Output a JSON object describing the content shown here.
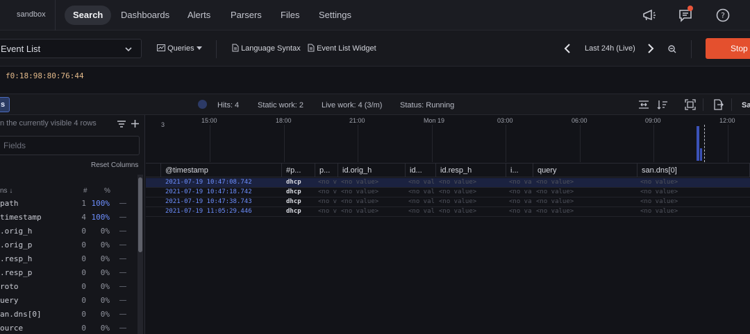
{
  "nav": {
    "repo": "sandbox",
    "items": [
      "Search",
      "Dashboards",
      "Alerts",
      "Parsers",
      "Files",
      "Settings"
    ]
  },
  "toolbar": {
    "widget": "Event List",
    "queries": "Queries",
    "language_syntax": "Language Syntax",
    "event_list_widget": "Event List Widget",
    "time_range": "Last 24h (Live)",
    "stop": "Stop"
  },
  "query": {
    "text": "f0:18:98:80:76:44"
  },
  "status": {
    "fields_tab": "s",
    "hits": "Hits: 4",
    "static_work": "Static work: 2",
    "live_work": "Live work: 4 (3/m)",
    "status": "Status: Running",
    "right_cut": "Sa"
  },
  "sidebar": {
    "note": "n the currently visible 4 rows",
    "filter_placeholder": "Fields",
    "reset_columns": "Reset Columns",
    "header_name": "ns ↓",
    "header_count": "#",
    "header_pct": "%",
    "fields": [
      {
        "name": "path",
        "count": "1",
        "pct": "100%",
        "hi": true
      },
      {
        "name": "timestamp",
        "count": "4",
        "pct": "100%",
        "hi": true
      },
      {
        "name": ".orig_h",
        "count": "0",
        "pct": "0%",
        "hi": false
      },
      {
        "name": ".orig_p",
        "count": "0",
        "pct": "0%",
        "hi": false
      },
      {
        "name": ".resp_h",
        "count": "0",
        "pct": "0%",
        "hi": false
      },
      {
        "name": ".resp_p",
        "count": "0",
        "pct": "0%",
        "hi": false
      },
      {
        "name": "roto",
        "count": "0",
        "pct": "0%",
        "hi": false
      },
      {
        "name": "uery",
        "count": "0",
        "pct": "0%",
        "hi": false
      },
      {
        "name": "an.dns[0]",
        "count": "0",
        "pct": "0%",
        "hi": false
      },
      {
        "name": "ource",
        "count": "0",
        "pct": "0%",
        "hi": false
      }
    ]
  },
  "timeline": {
    "y_max": "3",
    "ticks": [
      "15:00",
      "18:00",
      "21:00",
      "Mon 19",
      "03:00",
      "06:00",
      "09:00",
      "12:00"
    ]
  },
  "table": {
    "columns": [
      "@timestamp",
      "#p...",
      "p...",
      "id.orig_h",
      "id...",
      "id.resp_h",
      "i...",
      "query",
      "san.dns[0]"
    ],
    "rows": [
      {
        "timestamp": "2021-07-19 10:47:08.742",
        "path": "dhcp"
      },
      {
        "timestamp": "2021-07-19 10:47:18.742",
        "path": "dhcp"
      },
      {
        "timestamp": "2021-07-19 10:47:38.743",
        "path": "dhcp"
      },
      {
        "timestamp": "2021-07-19 11:05:29.446",
        "path": "dhcp"
      }
    ],
    "no_value": "<no value>",
    "no_value_short": "<no v",
    "no_value_mid": "<no val"
  }
}
